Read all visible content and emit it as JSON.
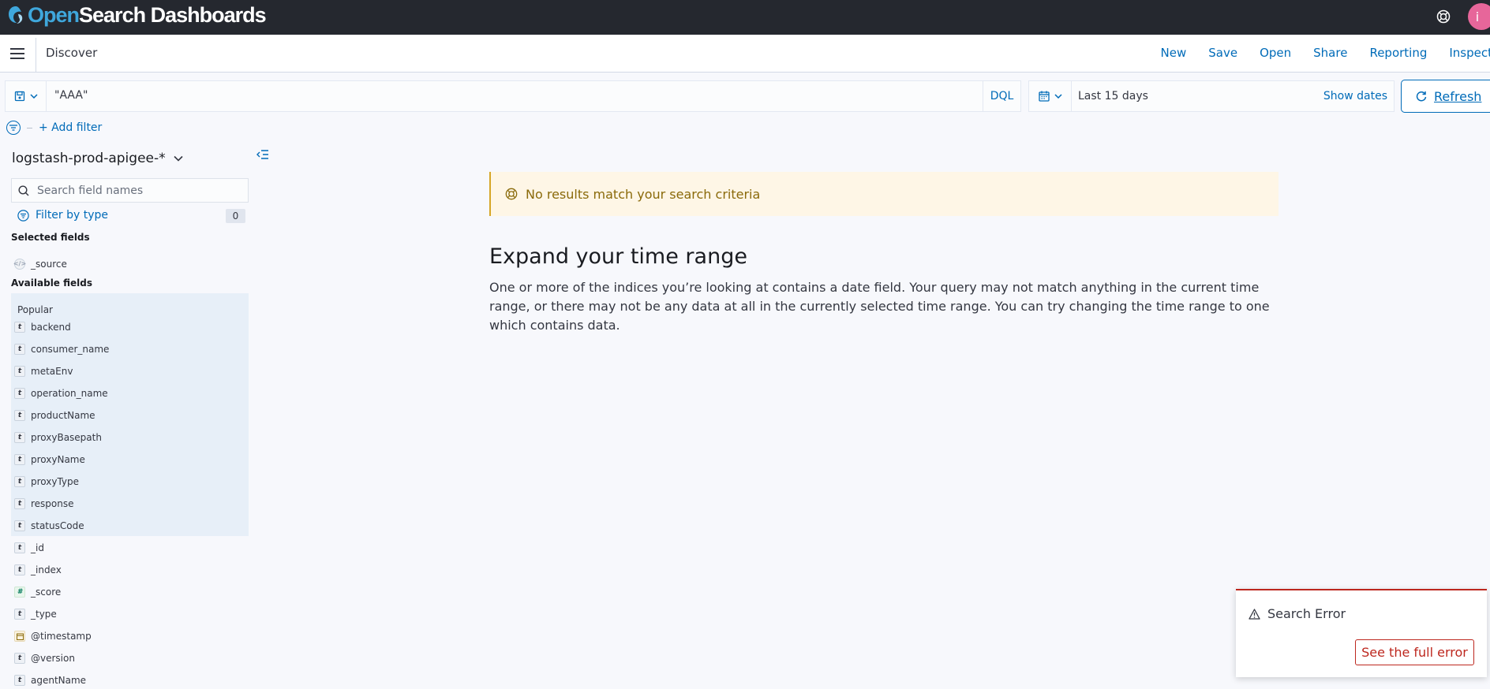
{
  "header": {
    "brand_open": "Open",
    "brand_rest": "Search Dashboards",
    "avatar_initial": "i"
  },
  "nav": {
    "breadcrumb": "Discover",
    "links": [
      "New",
      "Save",
      "Open",
      "Share",
      "Reporting",
      "Inspect"
    ]
  },
  "query": {
    "value": "\"AAA\"",
    "language": "DQL"
  },
  "date_picker": {
    "range": "Last 15 days",
    "show_dates": "Show dates",
    "refresh": "Refresh"
  },
  "filters": {
    "add_filter": "+ Add filter"
  },
  "sidebar": {
    "index_pattern": "logstash-prod-apigee-*",
    "search_placeholder": "Search field names",
    "filter_by_type": "Filter by type",
    "filter_count": "0",
    "selected_title": "Selected fields",
    "selected_fields": [
      {
        "name": "_source",
        "type": "source",
        "token": "</>"
      }
    ],
    "available_title": "Available fields",
    "popular_label": "Popular",
    "popular_fields": [
      {
        "name": "backend",
        "token": "t"
      },
      {
        "name": "consumer_name",
        "token": "t"
      },
      {
        "name": "metaEnv",
        "token": "t"
      },
      {
        "name": "operation_name",
        "token": "t"
      },
      {
        "name": "productName",
        "token": "t"
      },
      {
        "name": "proxyBasepath",
        "token": "t"
      },
      {
        "name": "proxyName",
        "token": "t"
      },
      {
        "name": "proxyType",
        "token": "t"
      },
      {
        "name": "response",
        "token": "t"
      },
      {
        "name": "statusCode",
        "token": "t"
      }
    ],
    "other_fields": [
      {
        "name": "_id",
        "token": "t",
        "type": "string"
      },
      {
        "name": "_index",
        "token": "t",
        "type": "string"
      },
      {
        "name": "_score",
        "token": "#",
        "type": "number"
      },
      {
        "name": "_type",
        "token": "t",
        "type": "string"
      },
      {
        "name": "@timestamp",
        "token": "",
        "type": "date"
      },
      {
        "name": "@version",
        "token": "t",
        "type": "string"
      },
      {
        "name": "agentName",
        "token": "t",
        "type": "string"
      }
    ]
  },
  "main": {
    "callout": "No results match your search criteria",
    "title": "Expand your time range",
    "body": "One or more of the indices you’re looking at contains a date field. Your query may not match anything in the current time range, or there may not be any data at all in the currently selected time range. You can try changing the time range to one which contains data."
  },
  "toast": {
    "title": "Search Error",
    "button": "See the full error"
  },
  "colors": {
    "header_bg": "#25282f",
    "link": "#006bb8",
    "danger": "#bd271e",
    "warning_bg": "#fef6e6",
    "popular_bg": "#e7eff8",
    "avatar": "#e7669a"
  }
}
